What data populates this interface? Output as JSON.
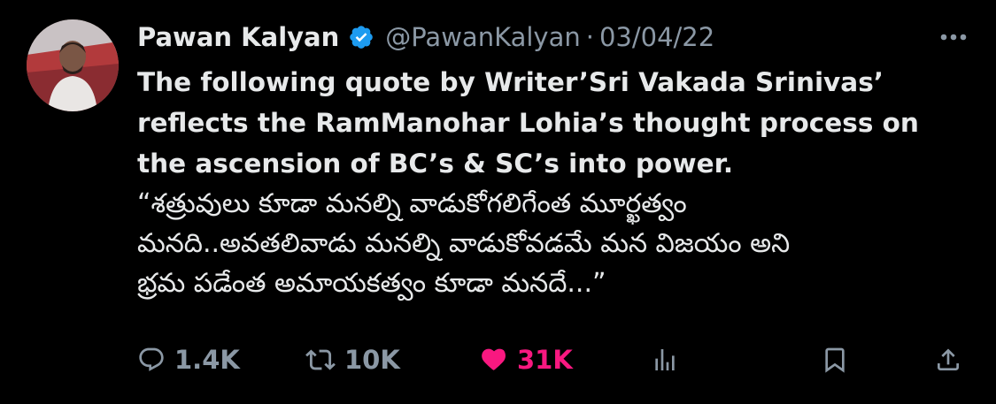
{
  "author": {
    "name": "Pawan Kalyan",
    "handle": "@PawanKalyan",
    "separator": "·",
    "date": "03/04/22",
    "verified": true
  },
  "tweet": {
    "english_text": "The following quote by Writer’Sri Vakada Srinivas’\nreflects the RamManohar Lohia’s thought process on\nthe ascension of BC’s & SC’s into power.",
    "telugu_text": "“శత్రువులు కూడా మనల్ని వాడుకోగలిగేంత మూర్ఖత్వం\nమనది..అవతలివాడు మనల్ని వాడుకోవడమే  మన విజయం అని\nభ్రమ పడేంత అమాయకత్వం కూడా మనదే...”"
  },
  "actions": {
    "replies": "1.4K",
    "retweets": "10K",
    "likes": "31K",
    "liked": true
  },
  "icons": {
    "verified": "verified-badge-icon",
    "more": "more-icon",
    "reply": "reply-icon",
    "retweet": "retweet-icon",
    "like": "heart-icon",
    "views": "views-icon",
    "bookmark": "bookmark-icon",
    "share": "share-icon"
  },
  "colors": {
    "background": "#000000",
    "text": "#e7e9ea",
    "secondary": "#8b98a5",
    "verified": "#1d9bf0",
    "like": "#f91880"
  }
}
